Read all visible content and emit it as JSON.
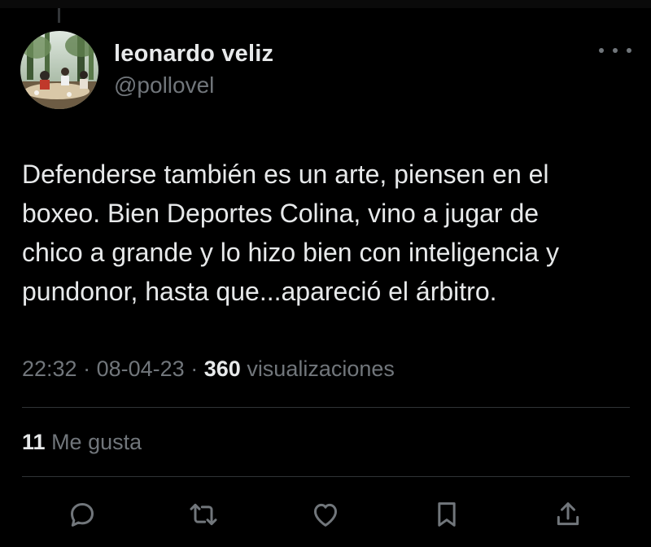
{
  "tweet": {
    "author": {
      "display_name": "leonardo veliz",
      "handle": "@pollovel"
    },
    "text": "Defenderse también es un arte, piensen en el\nboxeo. Bien Deportes Colina, vino a jugar de\nchico a grande y lo hizo bien con inteligencia y\npundonor, hasta que...apareció el árbitro.",
    "time": "22:32",
    "separator": "·",
    "date": "08-04-23",
    "views_count": "360",
    "views_label": "visualizaciones",
    "likes_count": "11",
    "likes_label": "Me gusta"
  },
  "actions": [
    {
      "icon": "reply-icon"
    },
    {
      "icon": "retweet-icon"
    },
    {
      "icon": "like-icon"
    },
    {
      "icon": "bookmark-icon"
    },
    {
      "icon": "share-icon"
    }
  ],
  "colors": {
    "background": "#000000",
    "primary_text": "#e7e9ea",
    "secondary_text": "#71767b",
    "divider": "#2f3336"
  }
}
